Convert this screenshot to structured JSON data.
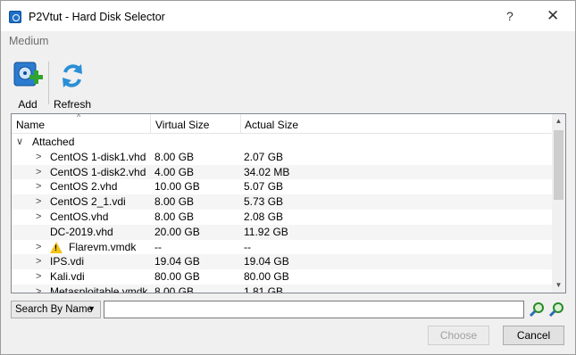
{
  "window": {
    "title": "P2Vtut - Hard Disk Selector",
    "help_label": "?",
    "close_label": "✕"
  },
  "section_label": "Medium",
  "toolbar": {
    "add_label": "Add",
    "refresh_label": "Refresh",
    "add_icon": "add-disk-icon",
    "refresh_icon": "refresh-icon"
  },
  "table": {
    "columns": [
      "Name",
      "Virtual Size",
      "Actual Size"
    ],
    "group": {
      "expander": "∨",
      "label": "Attached"
    },
    "rows": [
      {
        "expander": ">",
        "name": "CentOS 1-disk1.vhd",
        "virtual": "8.00 GB",
        "actual": "2.07 GB",
        "warning": false
      },
      {
        "expander": ">",
        "name": "CentOS 1-disk2.vhd",
        "virtual": "4.00 GB",
        "actual": "34.02 MB",
        "warning": false
      },
      {
        "expander": ">",
        "name": "CentOS 2.vhd",
        "virtual": "10.00 GB",
        "actual": "5.07 GB",
        "warning": false
      },
      {
        "expander": ">",
        "name": "CentOS 2_1.vdi",
        "virtual": "8.00 GB",
        "actual": "5.73 GB",
        "warning": false
      },
      {
        "expander": ">",
        "name": "CentOS.vhd",
        "virtual": "8.00 GB",
        "actual": "2.08 GB",
        "warning": false
      },
      {
        "expander": "",
        "name": "DC-2019.vhd",
        "virtual": "20.00 GB",
        "actual": "11.92 GB",
        "warning": false
      },
      {
        "expander": ">",
        "name": "Flarevm.vmdk",
        "virtual": "--",
        "actual": "--",
        "warning": true
      },
      {
        "expander": ">",
        "name": "IPS.vdi",
        "virtual": "19.04 GB",
        "actual": "19.04 GB",
        "warning": false
      },
      {
        "expander": ">",
        "name": "Kali.vdi",
        "virtual": "80.00 GB",
        "actual": "80.00 GB",
        "warning": false
      },
      {
        "expander": ">",
        "name": "Metasploitable.vmdk",
        "virtual": "8.00 GB",
        "actual": "1.81 GB",
        "warning": false
      }
    ]
  },
  "search": {
    "mode": "Search By Name",
    "value": "",
    "placeholder": ""
  },
  "buttons": {
    "choose": "Choose",
    "cancel": "Cancel"
  },
  "colors": {
    "accent": "#1f6fc5",
    "warning": "#f0c419"
  }
}
